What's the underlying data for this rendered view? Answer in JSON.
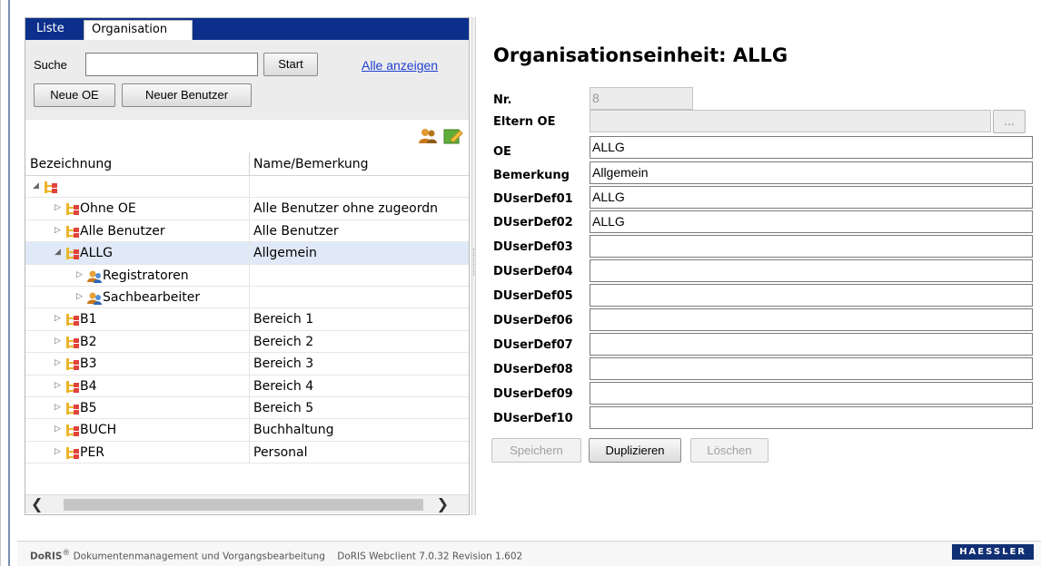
{
  "tabs": {
    "liste": "Liste",
    "organisation": "Organisation"
  },
  "search": {
    "label": "Suche",
    "value": "",
    "start_label": "Start",
    "show_all_label": "Alle anzeigen",
    "new_oe_label": "Neue OE",
    "new_user_label": "Neuer Benutzer"
  },
  "tree": {
    "columns": {
      "name": "Bezeichnung",
      "note": "Name/Bemerkung"
    },
    "rows": [
      {
        "name": "",
        "note": ""
      },
      {
        "name": "Ohne OE",
        "note": "Alle Benutzer ohne zugeordn"
      },
      {
        "name": "Alle Benutzer",
        "note": "Alle Benutzer"
      },
      {
        "name": "ALLG",
        "note": "Allgemein"
      },
      {
        "name": "Registratoren",
        "note": ""
      },
      {
        "name": "Sachbearbeiter",
        "note": ""
      },
      {
        "name": "B1",
        "note": "Bereich 1"
      },
      {
        "name": "B2",
        "note": "Bereich 2"
      },
      {
        "name": "B3",
        "note": "Bereich 3"
      },
      {
        "name": "B4",
        "note": "Bereich 4"
      },
      {
        "name": "B5",
        "note": "Bereich 5"
      },
      {
        "name": "BUCH",
        "note": "Buchhaltung"
      },
      {
        "name": "PER",
        "note": "Personal"
      }
    ]
  },
  "form": {
    "title": "Organisationseinheit: ALLG",
    "fields": [
      {
        "label": "Nr.",
        "value": "8"
      },
      {
        "label": "Eltern OE",
        "value": ""
      },
      {
        "label": "OE",
        "value": "ALLG"
      },
      {
        "label": "Bemerkung",
        "value": "Allgemein"
      },
      {
        "label": "DUserDef01",
        "value": "ALLG"
      },
      {
        "label": "DUserDef02",
        "value": "ALLG"
      },
      {
        "label": "DUserDef03",
        "value": ""
      },
      {
        "label": "DUserDef04",
        "value": ""
      },
      {
        "label": "DUserDef05",
        "value": ""
      },
      {
        "label": "DUserDef06",
        "value": ""
      },
      {
        "label": "DUserDef07",
        "value": ""
      },
      {
        "label": "DUserDef08",
        "value": ""
      },
      {
        "label": "DUserDef09",
        "value": ""
      },
      {
        "label": "DUserDef10",
        "value": ""
      }
    ],
    "browse_label": "...",
    "save_label": "Speichern",
    "duplicate_label": "Duplizieren",
    "delete_label": "Löschen"
  },
  "footer": {
    "brand": "DoRIS",
    "reg": "®",
    "text": " Dokumentenmanagement und Vorgangsbearbeitung    DoRIS Webclient 7.0.32 Revision 1.602",
    "logo": "HAESSLER"
  },
  "colors": {
    "tab_bar": "#0b2f8a",
    "link": "#1f3fd0",
    "selected_row": "#dfe9f7",
    "logo_bg": "#102f74"
  },
  "icons": {
    "ou_node": "org-unit-icon",
    "group_node": "user-group-icon"
  }
}
